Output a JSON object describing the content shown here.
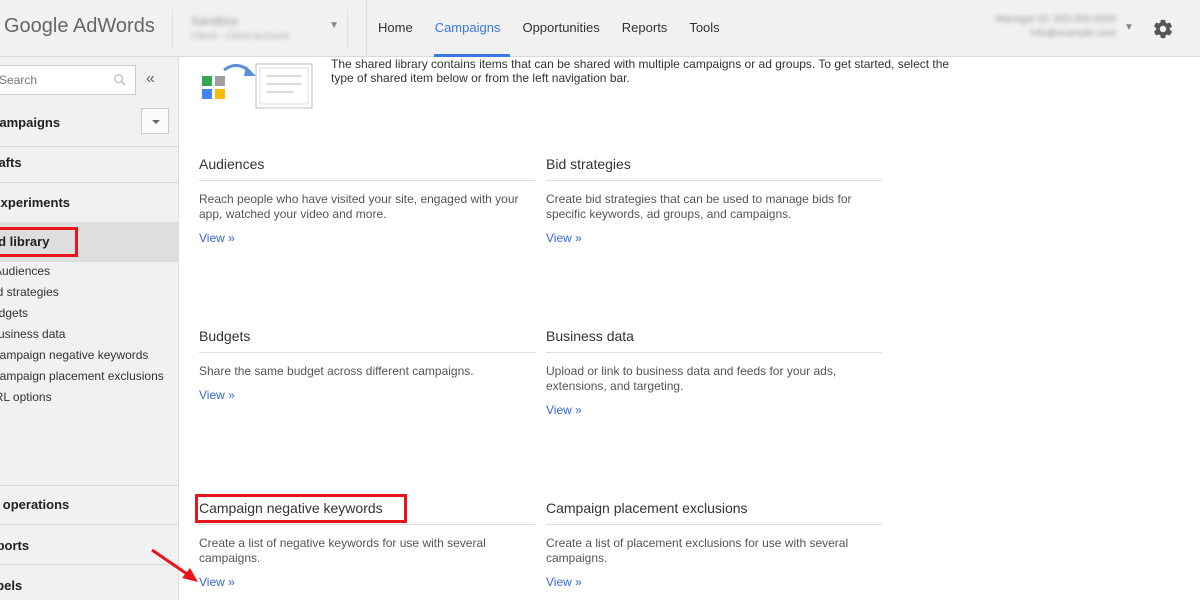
{
  "header": {
    "logo_text": "Google AdWords",
    "account_name": "Sandbox",
    "account_sub": "Client · Client account",
    "nav": [
      "Home",
      "Campaigns",
      "Opportunities",
      "Reports",
      "Tools"
    ],
    "active_nav": "Campaigns",
    "customer_line1": "Manager ID: 000-000-0000",
    "customer_line2": "info@example.com",
    "accent": "#3b78e7"
  },
  "sidebar": {
    "search_placeholder": "Search",
    "items": [
      "Campaigns",
      "Drafts",
      "Experiments",
      "Shared library"
    ],
    "sub_items": [
      "Audiences",
      "Bid strategies",
      "Budgets",
      "Business data",
      "Campaign negative keywords",
      "Campaign placement exclusions",
      "URL options"
    ],
    "bottom_items": [
      "Bulk operations",
      "Reports",
      "Labels"
    ]
  },
  "main": {
    "intro": "The shared library contains items that can be shared with multiple campaigns or ad groups. To get started, select the type of shared item below or from the left navigation bar.",
    "cards": [
      {
        "title": "Audiences",
        "desc": "Reach people who have visited your site, engaged with your app, watched your video and more.",
        "link": "View »"
      },
      {
        "title": "Bid strategies",
        "desc": "Create bid strategies that can be used to manage bids for specific keywords, ad groups, and campaigns.",
        "link": "View »"
      },
      {
        "title": "Budgets",
        "desc": "Share the same budget across different campaigns.",
        "link": "View »"
      },
      {
        "title": "Business data",
        "desc": "Upload or link to business data and feeds for your ads, extensions, and targeting.",
        "link": "View »"
      },
      {
        "title": "Campaign negative keywords",
        "desc": "Create a list of negative keywords for use with several campaigns.",
        "link": "View »"
      },
      {
        "title": "Campaign placement exclusions",
        "desc": "Create a list of placement exclusions for use with several campaigns.",
        "link": "View »"
      }
    ]
  },
  "annotation_color": "#e8141c"
}
